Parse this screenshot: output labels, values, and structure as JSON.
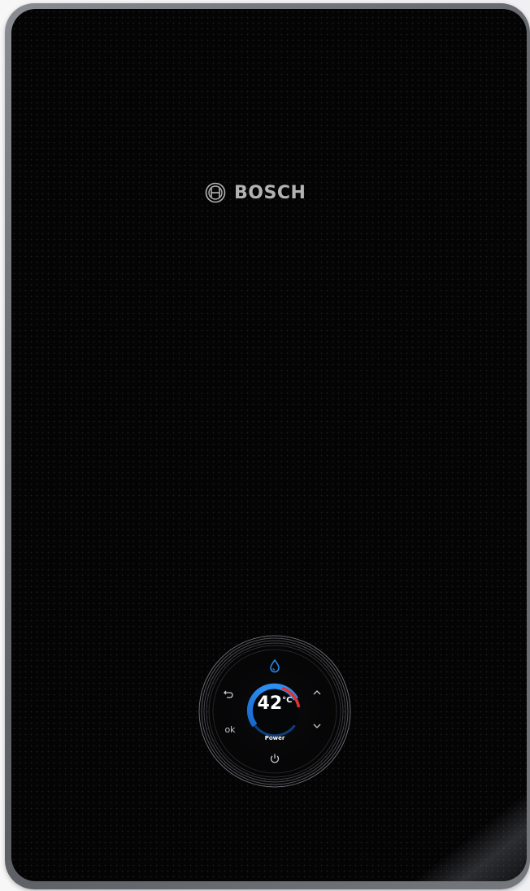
{
  "brand": {
    "name": "BOSCH",
    "logo_icon": "bosch-armature-icon"
  },
  "controller": {
    "temperature_value": "42",
    "temperature_unit": "°C",
    "mode_label": "Power",
    "ok_label": "ok",
    "icons": {
      "top": "water-drop-icon",
      "back": "back-arrow-icon",
      "up": "chevron-up-icon",
      "down": "chevron-down-icon",
      "power": "power-icon"
    }
  },
  "colors": {
    "panel": "#040405",
    "frame": "#6b6e73",
    "brand_text": "#b3b3b6",
    "ring_blue": "#1f7fe0",
    "ring_red": "#e03333",
    "drop_blue": "#2a84e6",
    "ui_text": "#c9c9cc"
  }
}
